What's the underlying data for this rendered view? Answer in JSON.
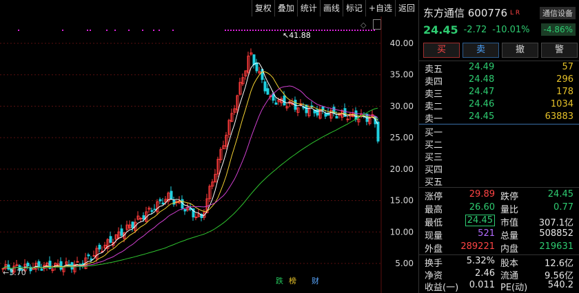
{
  "toolbar": {
    "items": [
      "复权",
      "叠加",
      "统计",
      "画线",
      "标记",
      "+自选",
      "返回"
    ]
  },
  "chart": {
    "y_tick_labels": [
      "40.00",
      "35.00",
      "30.00",
      "25.00",
      "20.00",
      "15.00",
      "10.00",
      "5.00"
    ],
    "high_marker": "41.88",
    "low_marker": "3.70",
    "events": {
      "die": "跌",
      "bang": "榜",
      "cai": "财"
    },
    "colors": {
      "up": "#ff3b3b",
      "down": "#1fd0e0",
      "ma5": "#ffffff",
      "ma10": "#f5d232",
      "ma20": "#d040d0",
      "ma60": "#2fc42f",
      "grid": "#5a1010"
    }
  },
  "chart_data": {
    "type": "candlestick",
    "y_ticks": [
      40,
      35,
      30,
      25,
      20,
      15,
      10,
      5
    ],
    "last_close": 24.45,
    "high": 41.88,
    "low": 3.7
  },
  "panel": {
    "name": "东方通信 600776",
    "badge": "L R",
    "tag": "通信设备",
    "price": "24.45",
    "change": "-2.72",
    "change_pct": "-10.01%",
    "alert_pct": "-4.86%",
    "buttons": {
      "buy": "买",
      "sell": "卖",
      "cancel": "撤",
      "alert": "警"
    },
    "sells": [
      {
        "label": "卖五",
        "price": "24.49",
        "vol": "57"
      },
      {
        "label": "卖四",
        "price": "24.48",
        "vol": "296"
      },
      {
        "label": "卖三",
        "price": "24.47",
        "vol": "178"
      },
      {
        "label": "卖二",
        "price": "24.46",
        "vol": "1034"
      },
      {
        "label": "卖一",
        "price": "24.45",
        "vol": "63883"
      }
    ],
    "buys": [
      {
        "label": "买一"
      },
      {
        "label": "买二"
      },
      {
        "label": "买三"
      },
      {
        "label": "买四"
      },
      {
        "label": "买五"
      }
    ],
    "stats": [
      {
        "l1": "涨停",
        "v1": "29.89",
        "c1": "red",
        "l2": "跌停",
        "v2": "24.45",
        "c2": "green"
      },
      {
        "l1": "最高",
        "v1": "26.60",
        "c1": "green",
        "l2": "量比",
        "v2": "0.77",
        "c2": "green"
      },
      {
        "l1": "最低",
        "v1": "24.45",
        "c1": "green",
        "l2": "市值",
        "v2": "307.1亿",
        "c2": "white"
      },
      {
        "l1": "现量",
        "v1": "521",
        "c1": "purple",
        "l2": "总量",
        "v2": "508852",
        "c2": "white"
      },
      {
        "l1": "外盘",
        "v1": "289221",
        "c1": "red",
        "l2": "内盘",
        "v2": "219631",
        "c2": "green"
      },
      {
        "l1": "换手",
        "v1": "5.32%",
        "c1": "white",
        "l2": "股本",
        "v2": "12.6亿",
        "c2": "white"
      },
      {
        "l1": "净资",
        "v1": "2.46",
        "c1": "white",
        "l2": "流通",
        "v2": "9.56亿",
        "c2": "white"
      },
      {
        "l1": "收益(一)",
        "v1": "0.011",
        "c1": "white",
        "l2": "PE(动)",
        "v2": "540.2",
        "c2": "white"
      }
    ]
  }
}
